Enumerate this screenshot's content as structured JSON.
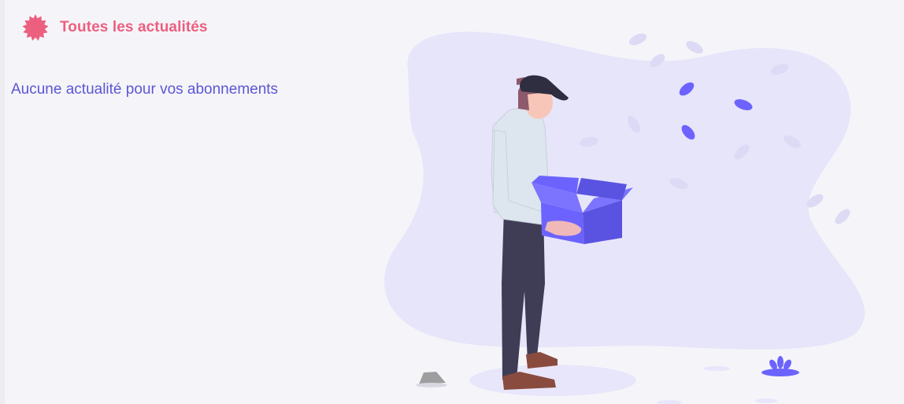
{
  "header": {
    "icon": "badge-burst-icon",
    "title": "Toutes les actualités"
  },
  "main": {
    "empty_message": "Aucune actualité pour vos abonnements"
  },
  "illustration": {
    "name": "person-holding-empty-box-illustration"
  },
  "colors": {
    "accent": "#ec5f7f",
    "primary": "#6c63ff",
    "blob": "#e7e5fa",
    "background": "#f5f5f9"
  }
}
